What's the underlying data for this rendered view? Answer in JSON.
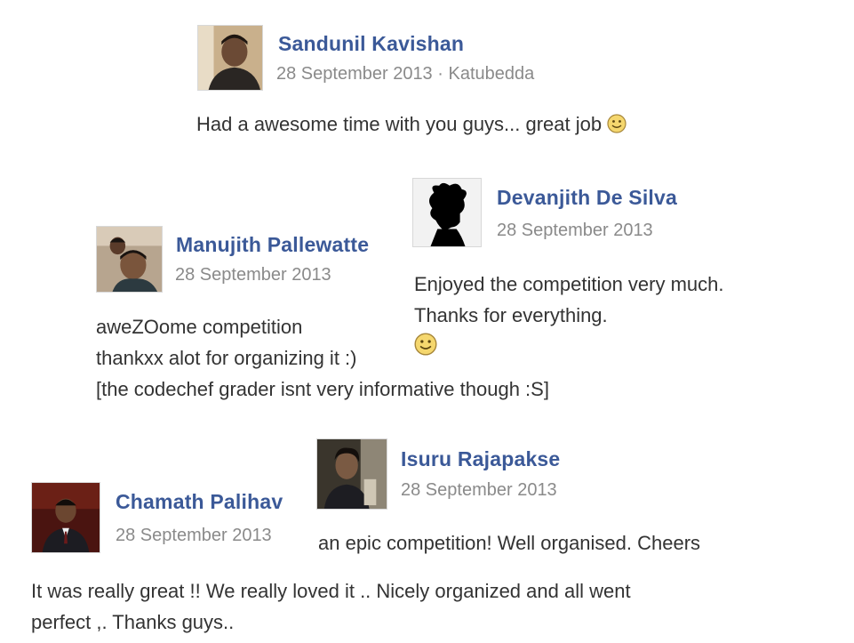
{
  "posts": [
    {
      "author": "Sandunil Kavishan",
      "date": "28 September 2013",
      "location": "Katubedda",
      "separator": "·",
      "lines": [
        "Had a awesome time with you guys... great job"
      ]
    },
    {
      "author": "Manujith Pallewatte",
      "date": "28 September 2013",
      "lines": [
        "aweZOome competition",
        "thankxx alot for organizing it :)",
        "[the codechef grader isnt very informative though :S]"
      ]
    },
    {
      "author": "Devanjith De Silva",
      "date": "28 September 2013",
      "lines": [
        "Enjoyed the competition very much.",
        "Thanks for everything."
      ]
    },
    {
      "author": "Chamath Palihav",
      "date": "28 September 2013",
      "lines": [
        "It was really great !! We really loved it .. Nicely organized and all went",
        "perfect ,. Thanks guys.."
      ]
    },
    {
      "author": "Isuru Rajapakse",
      "date": "28 September 2013",
      "lines": [
        "an epic competition! Well organised. Cheers"
      ]
    }
  ],
  "icons": {
    "emoticon": "smiley-icon",
    "silhouette": "profile-silhouette"
  },
  "colors": {
    "name": "#3b5998",
    "meta": "#8a8a8a",
    "text": "#333333"
  }
}
